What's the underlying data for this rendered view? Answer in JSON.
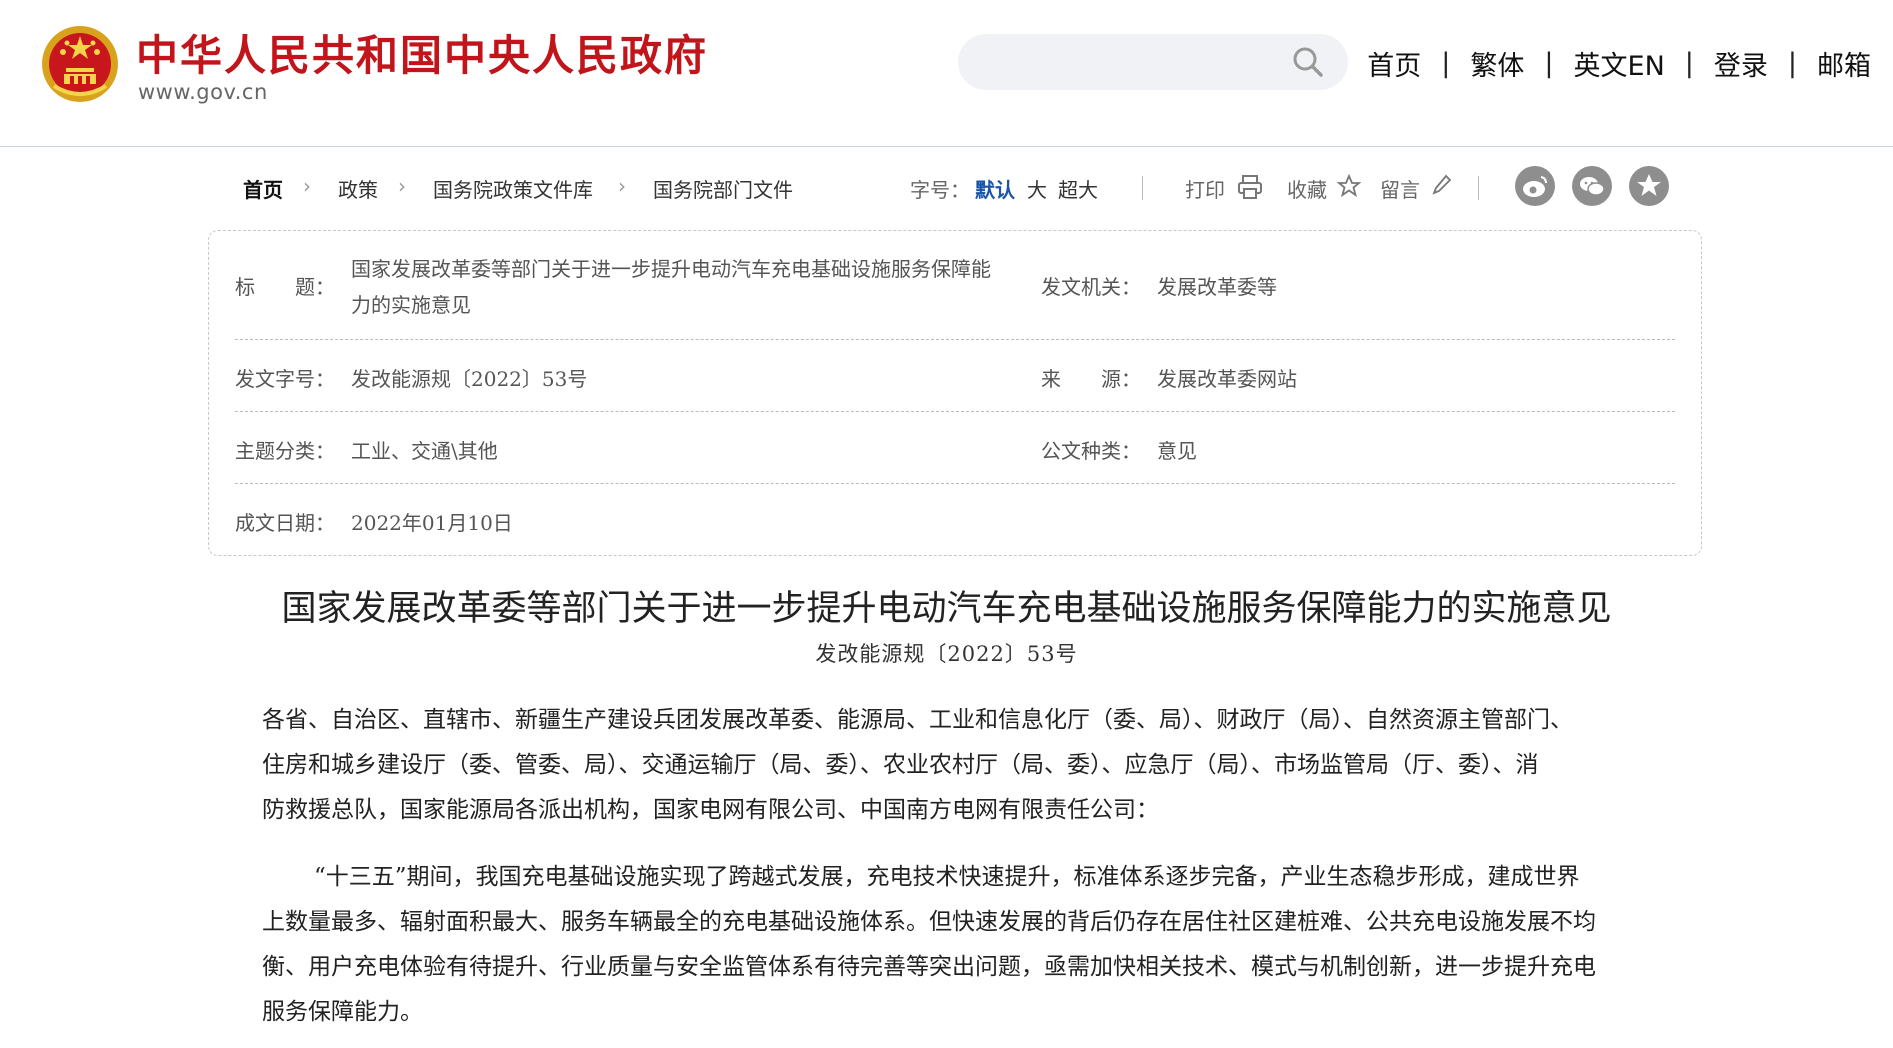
{
  "header": {
    "site_title": "中华人民共和国中央人民政府",
    "site_url": "www.gov.cn",
    "search_placeholder": "",
    "nav": [
      "首页",
      "繁体",
      "英文EN",
      "登录",
      "邮箱"
    ],
    "brand_color": "#c1151b"
  },
  "toolbar": {
    "breadcrumb": [
      "首页",
      "政策",
      "国务院政策文件库",
      "国务院部门文件"
    ],
    "font_size_label": "字号：",
    "font_options": [
      "默认",
      "大",
      "超大"
    ],
    "print_label": "打印",
    "favorite_label": "收藏",
    "comment_label": "留言",
    "share_icons": [
      "weibo-icon",
      "wechat-icon",
      "star-icon"
    ]
  },
  "info": {
    "title_label": "标　　题：",
    "title_line1": "国家发展改革委等部门关于进一步提升电动汽车充电基础设施服务保障能",
    "title_line2": "力的实施意见",
    "issuer_label": "发文机关：",
    "issuer": "发展改革委等",
    "doc_no_label": "发文字号：",
    "doc_no": "发改能源规〔2022〕53号",
    "source_label": "来　　源：",
    "source": "发展改革委网站",
    "category_label": "主题分类：",
    "category": "工业、交通\\其他",
    "type_label": "公文种类：",
    "type": "意见",
    "date_label": "成文日期：",
    "date": "2022年01月10日"
  },
  "article": {
    "title": "国家发展改革委等部门关于进一步提升电动汽车充电基础设施服务保障能力的实施意见",
    "doc_no": "发改能源规〔2022〕53号",
    "para1": [
      "各省、自治区、直辖市、新疆生产建设兵团发展改革委、能源局、工业和信息化厅（委、局）、财政厅（局）、自然资源主管部门、",
      "住房和城乡建设厅（委、管委、局）、交通运输厅（局、委）、农业农村厅（局、委）、应急厅（局）、市场监管局（厅、委）、消",
      "防救援总队，国家能源局各派出机构，国家电网有限公司、中国南方电网有限责任公司："
    ],
    "para2": [
      "“十三五”期间，我国充电基础设施实现了跨越式发展，充电技术快速提升，标准体系逐步完备，产业生态稳步形成，建成世界",
      "上数量最多、辐射面积最大、服务车辆最全的充电基础设施体系。但快速发展的背后仍存在居住社区建桩难、公共充电设施发展不均",
      "衡、用户充电体验有待提升、行业质量与安全监管体系有待完善等突出问题，亟需加快相关技术、模式与机制创新，进一步提升充电",
      "服务保障能力。"
    ]
  }
}
